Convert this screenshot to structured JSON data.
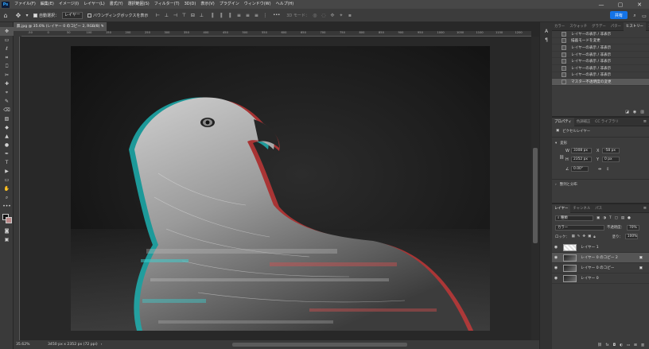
{
  "menubar": {
    "logo": "Ps",
    "items": [
      "ファイル(F)",
      "編集(E)",
      "イメージ(I)",
      "レイヤー(L)",
      "書式(Y)",
      "選択範囲(S)",
      "フィルター(T)",
      "3D(D)",
      "表示(V)",
      "プラグイン",
      "ウィンドウ(W)",
      "ヘルプ(H)"
    ]
  },
  "options": {
    "auto_select_label": "自動選択：",
    "auto_select_value": "レイヤー",
    "bbox_label": "バウンディングボックスを表示",
    "more": "•••",
    "mode3d_label": "3D モード：",
    "share_label": "共有"
  },
  "tools": [
    "✥",
    "▭",
    "ℓ",
    "⌗",
    "⎕",
    "✂",
    "✚",
    "⌖",
    "✎",
    "⌫",
    "▧",
    "◆",
    "▲",
    "●",
    "✒",
    "T",
    "▶",
    "▭",
    "✋",
    "⌕",
    "•••"
  ],
  "document": {
    "tab_title": "無.jpg @ 35.6% (レイヤー 0 のコピー 2, RGB/8) *",
    "ruler_numbers": [
      "-50",
      "0",
      "50",
      "100",
      "150",
      "200",
      "250",
      "300",
      "350",
      "400",
      "450",
      "500",
      "550",
      "600",
      "650",
      "700",
      "750",
      "800",
      "850",
      "900",
      "950",
      "1000",
      "1050",
      "1100",
      "1150",
      "1200",
      "1250"
    ],
    "status_zoom": "35.62%",
    "status_size": "3450 px x 2352 px (72 ppi)"
  },
  "history": {
    "tabs": [
      "カラー",
      "スウォッチ",
      "グラデー",
      "パター",
      "ヒストリー",
      "コメント"
    ],
    "active_tab": 4,
    "items": [
      "レイヤーの表示 / 非表示",
      "描画モードを変更",
      "レイヤーの表示 / 非表示",
      "レイヤーの表示 / 非表示",
      "レイヤーの表示 / 非表示",
      "レイヤーの表示 / 非表示",
      "レイヤーの表示 / 非表示",
      "マスター不透明度の変更"
    ]
  },
  "properties": {
    "tabs": [
      "プロパティ",
      "色調補正",
      "CC ライブラリ"
    ],
    "pixel_layer": "ピクセルレイヤー",
    "transform_label": "変形",
    "w_label": "W",
    "w_value": "3308 px",
    "h_label": "H",
    "h_value": "2352 px",
    "x_label": "X",
    "x_value": "-58 px",
    "y_label": "Y",
    "y_value": "0 px",
    "angle_value": "0.00°",
    "align_label": "整列と分布"
  },
  "layers": {
    "tabs": [
      "レイヤー",
      "チャンネル",
      "パス"
    ],
    "filter_label": "種類",
    "blend_mode": "カラー",
    "opacity_label": "不透明度：",
    "opacity_value": "70%",
    "lock_label": "ロック：",
    "fill_label": "塗り：",
    "fill_value": "100%",
    "rows": [
      {
        "name": "レイヤー 1",
        "visible": true,
        "active": false
      },
      {
        "name": "レイヤー 0 のコピー 2",
        "visible": true,
        "active": true
      },
      {
        "name": "レイヤー 0 のコピー",
        "visible": true,
        "active": false
      },
      {
        "name": "レイヤー 0",
        "visible": true,
        "active": false
      }
    ]
  }
}
